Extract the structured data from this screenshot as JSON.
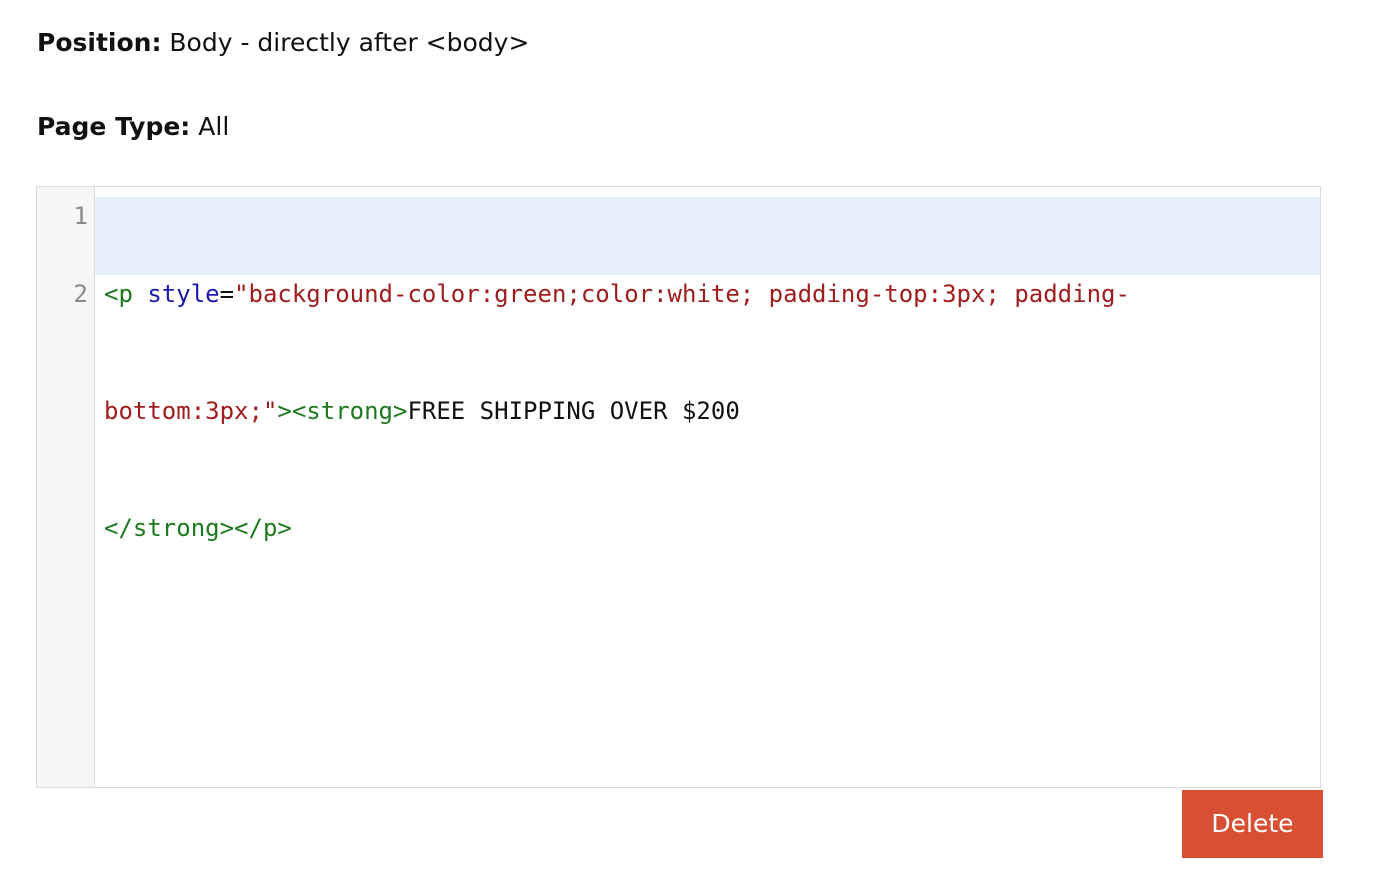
{
  "position": {
    "label": "Position:",
    "value": "Body - directly after <body>"
  },
  "page_type": {
    "label": "Page Type:",
    "value": "All"
  },
  "editor": {
    "line_numbers": [
      "1",
      "2"
    ],
    "lines": [
      {
        "row1": [
          {
            "type": "tag",
            "text": "<p"
          },
          {
            "type": "text",
            "text": " "
          },
          {
            "type": "attr",
            "text": "style"
          },
          {
            "type": "text",
            "text": "="
          },
          {
            "type": "str",
            "text": "\"background-color:green;color:white; padding-top:3px; padding-"
          }
        ],
        "row2": [
          {
            "type": "str",
            "text": "bottom:3px;\""
          },
          {
            "type": "tag",
            "text": "><strong>"
          },
          {
            "type": "text",
            "text": "FREE SHIPPING OVER $200"
          }
        ]
      },
      {
        "row1": [
          {
            "type": "tag",
            "text": "</strong></p>"
          }
        ]
      }
    ]
  },
  "actions": {
    "delete_label": "Delete"
  },
  "colors": {
    "delete_button_bg": "#d85034",
    "active_line_bg": "#e8f0fb",
    "tag": "#1e7a1e",
    "attribute": "#1a1ab0",
    "string": "#a11d1d"
  }
}
